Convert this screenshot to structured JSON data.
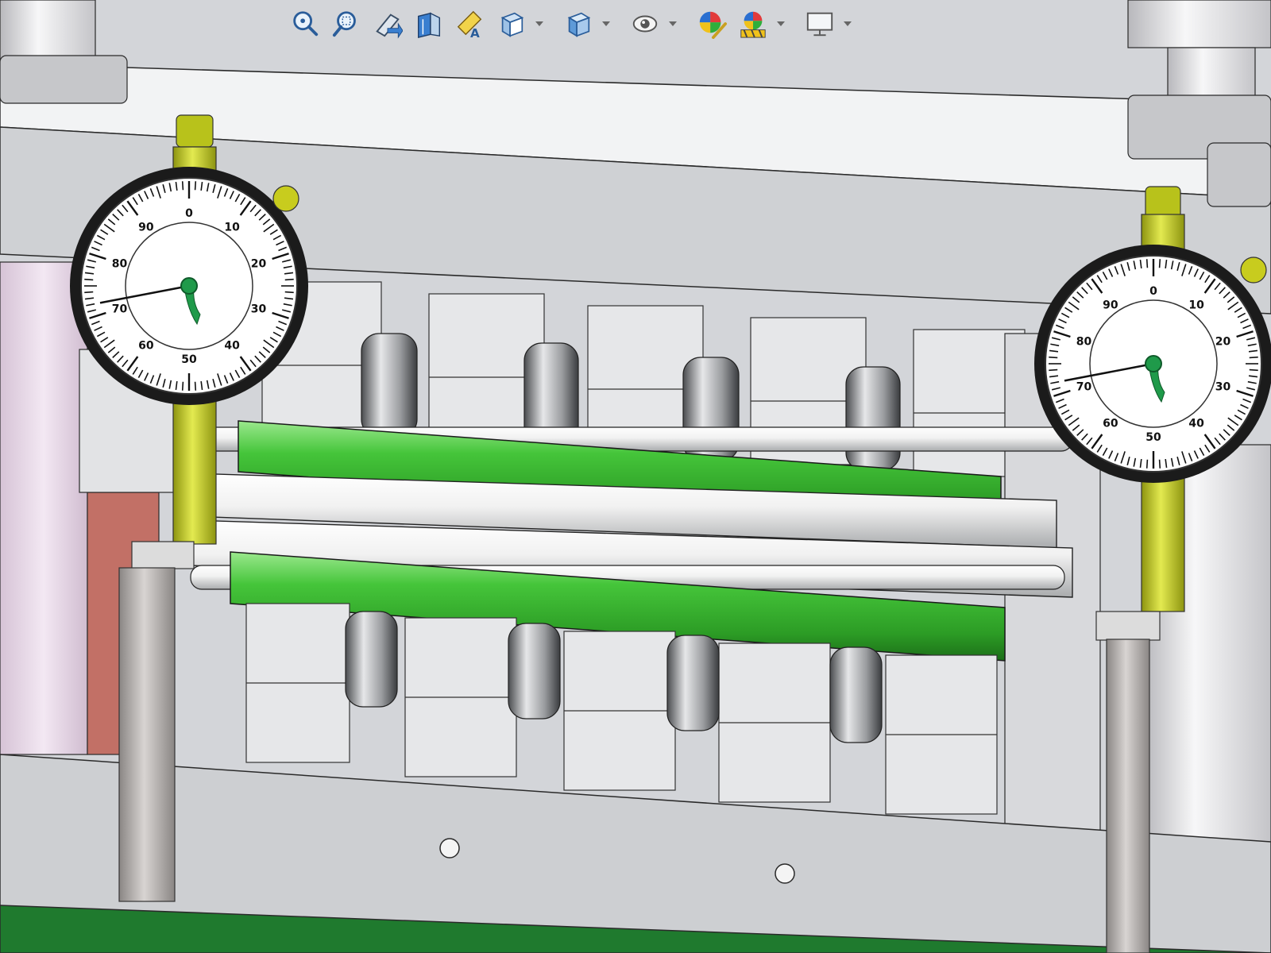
{
  "app": {
    "window_type": "3D CAD assembly viewport",
    "background_color": "#d4d6da"
  },
  "heads_up_toolbar": {
    "buttons": [
      {
        "id": "zoom-to-fit",
        "icon": "zoom-to-fit-icon",
        "dropdown": false
      },
      {
        "id": "zoom-to-area",
        "icon": "zoom-to-area-icon",
        "dropdown": false
      },
      {
        "id": "previous-view",
        "icon": "previous-view-icon",
        "dropdown": false
      },
      {
        "id": "section-view",
        "icon": "section-view-icon",
        "dropdown": false
      },
      {
        "id": "dynamic-annotation-views",
        "icon": "dynamic-annotation-icon",
        "dropdown": false
      },
      {
        "id": "view-orientation",
        "icon": "view-orientation-cube-icon",
        "dropdown": true
      },
      {
        "id": "display-style",
        "icon": "display-style-cube-icon",
        "dropdown": true
      },
      {
        "id": "hide-show-items",
        "icon": "eye-icon",
        "dropdown": true
      },
      {
        "id": "edit-appearance",
        "icon": "appearance-ball-icon",
        "dropdown": false
      },
      {
        "id": "apply-scene",
        "icon": "scene-icon",
        "dropdown": true
      },
      {
        "id": "view-settings",
        "icon": "monitor-icon",
        "dropdown": true
      }
    ]
  },
  "model": {
    "colors": {
      "frame_gray": "#cfd1d4",
      "block_white": "#e8e9eb",
      "green_roller": "#3fbf36",
      "white_roller": "#f0f0f0",
      "gauge_rod_yellow": "#c7d21a",
      "red_block": "#c27066",
      "pink_cylinder": "#e8d8e8",
      "green_floor": "#1f7a2e"
    },
    "dial_gauges": [
      {
        "id": "left",
        "tick_labels": [
          "10",
          "20",
          "30",
          "40",
          "50",
          "60",
          "70",
          "80",
          "90",
          "0"
        ],
        "needle_value": 72
      },
      {
        "id": "right",
        "tick_labels": [
          "10",
          "20",
          "30",
          "40",
          "50",
          "60",
          "70",
          "80",
          "90",
          "0"
        ],
        "needle_value": 72
      }
    ],
    "rollers": [
      {
        "id": "upper-green",
        "color": "green"
      },
      {
        "id": "upper-white",
        "color": "white"
      },
      {
        "id": "lower-white",
        "color": "white"
      },
      {
        "id": "lower-green",
        "color": "green"
      }
    ]
  }
}
